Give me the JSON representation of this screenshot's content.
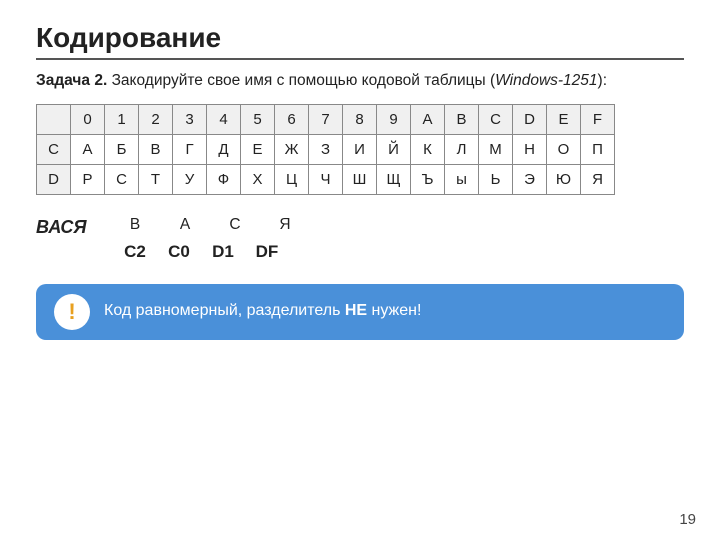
{
  "header": {
    "title": "Кодирование"
  },
  "task": {
    "label": "Задача 2.",
    "description": " Закодируйте свое имя с помощью кодовой таблицы (",
    "italic_part": "Windows-1251",
    "end": "):"
  },
  "table": {
    "header_row": [
      "",
      "0",
      "1",
      "2",
      "3",
      "4",
      "5",
      "6",
      "7",
      "8",
      "9",
      "A",
      "B",
      "C",
      "D",
      "E",
      "F"
    ],
    "row_c": [
      "C",
      "А",
      "Б",
      "В",
      "Г",
      "Д",
      "Е",
      "Ж",
      "З",
      "И",
      "Й",
      "К",
      "Л",
      "М",
      "Н",
      "О",
      "П"
    ],
    "row_d": [
      "D",
      "Р",
      "С",
      "Т",
      "У",
      "Ф",
      "Х",
      "Ц",
      "Ч",
      "Ш",
      "Щ",
      "Ъ",
      "ы",
      "Ь",
      "Э",
      "Ю",
      "Я"
    ]
  },
  "example": {
    "word": "ВАСЯ",
    "letters": [
      "В",
      "А",
      "С",
      "Я"
    ],
    "codes": [
      "C2",
      "C0",
      "D1",
      "DF"
    ]
  },
  "notice": {
    "icon": "!",
    "text_before_bold": "Код равномерный, разделитель ",
    "bold_text": "НЕ",
    "text_after_bold": " нужен!"
  },
  "page_number": "19"
}
